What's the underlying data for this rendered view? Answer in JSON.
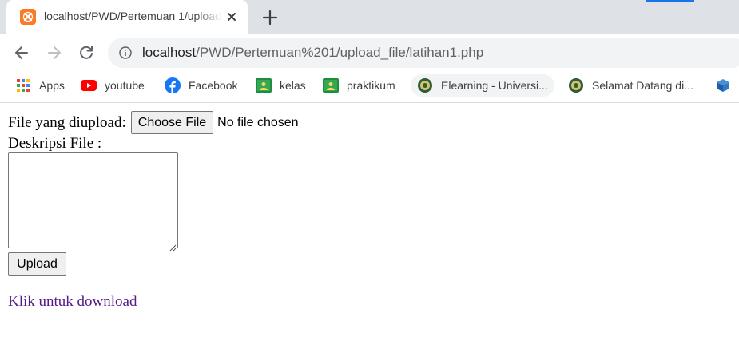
{
  "browser": {
    "tab": {
      "title": "localhost/PWD/Pertemuan 1/upload_file/latihan1.php",
      "favicon_color": "#fb7a24",
      "favicon": "xampp-icon"
    },
    "new_tab": "plus-icon",
    "nav": {
      "back": "arrow-left-icon",
      "forward": "arrow-right-icon",
      "reload": "reload-icon"
    },
    "url": {
      "host": "localhost",
      "path": "/PWD/Pertemuan%201/upload_file/latihan1.php"
    },
    "bookmarks": [
      {
        "label": "Apps",
        "icon": "apps-grid-icon"
      },
      {
        "label": "youtube",
        "icon": "youtube-icon"
      },
      {
        "label": "Facebook",
        "icon": "facebook-icon"
      },
      {
        "label": "kelas",
        "icon": "classroom-icon"
      },
      {
        "label": "praktikum",
        "icon": "classroom-icon"
      },
      {
        "label": "Elearning - Universi...",
        "icon": "university-logo-icon"
      },
      {
        "label": "Selamat Datang di...",
        "icon": "university-logo-icon"
      }
    ]
  },
  "page": {
    "file_label": "File yang diupload:",
    "choose_file_button": "Choose File",
    "no_file_text": "No file chosen",
    "description_label": "Deskripsi File :",
    "description_value": "",
    "upload_button": "Upload",
    "download_link": "Klik untuk download",
    "link_color": "#551a8b"
  }
}
